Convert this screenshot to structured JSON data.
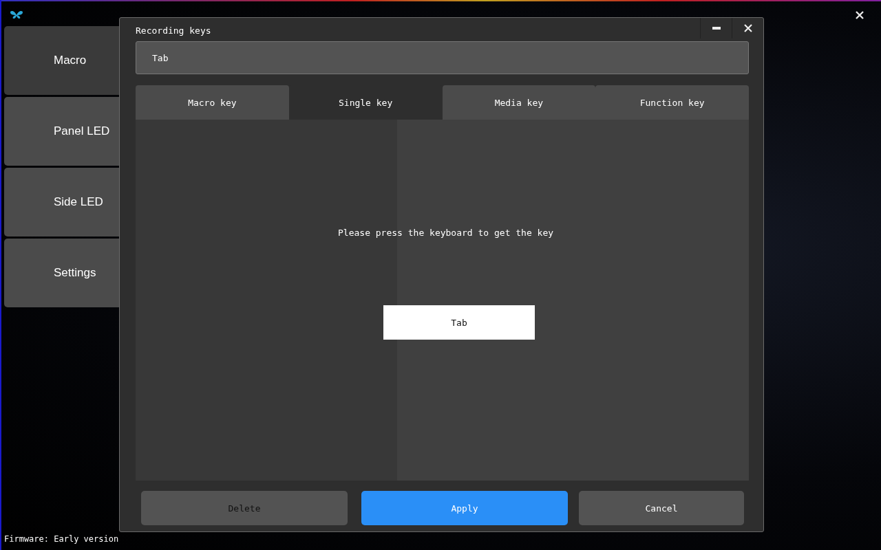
{
  "sidebar": {
    "items": [
      {
        "label": "Macro",
        "selected": true
      },
      {
        "label": "Panel LED",
        "selected": false
      },
      {
        "label": "Side LED",
        "selected": false
      },
      {
        "label": "Settings",
        "selected": false
      }
    ]
  },
  "status_bar": {
    "text": "Firmware: Early version"
  },
  "dialog": {
    "title": "Recording keys",
    "value": "Tab",
    "tabs": [
      {
        "label": "Macro key",
        "selected": false
      },
      {
        "label": "Single key",
        "selected": true
      },
      {
        "label": "Media key",
        "selected": false
      },
      {
        "label": "Function key",
        "selected": false
      }
    ],
    "prompt": "Please press the keyboard to get the key",
    "captured_key": "Tab",
    "buttons": [
      {
        "label": "Delete",
        "kind": "secondary"
      },
      {
        "label": "Apply",
        "kind": "primary"
      },
      {
        "label": "Cancel",
        "kind": "secondary"
      }
    ]
  }
}
